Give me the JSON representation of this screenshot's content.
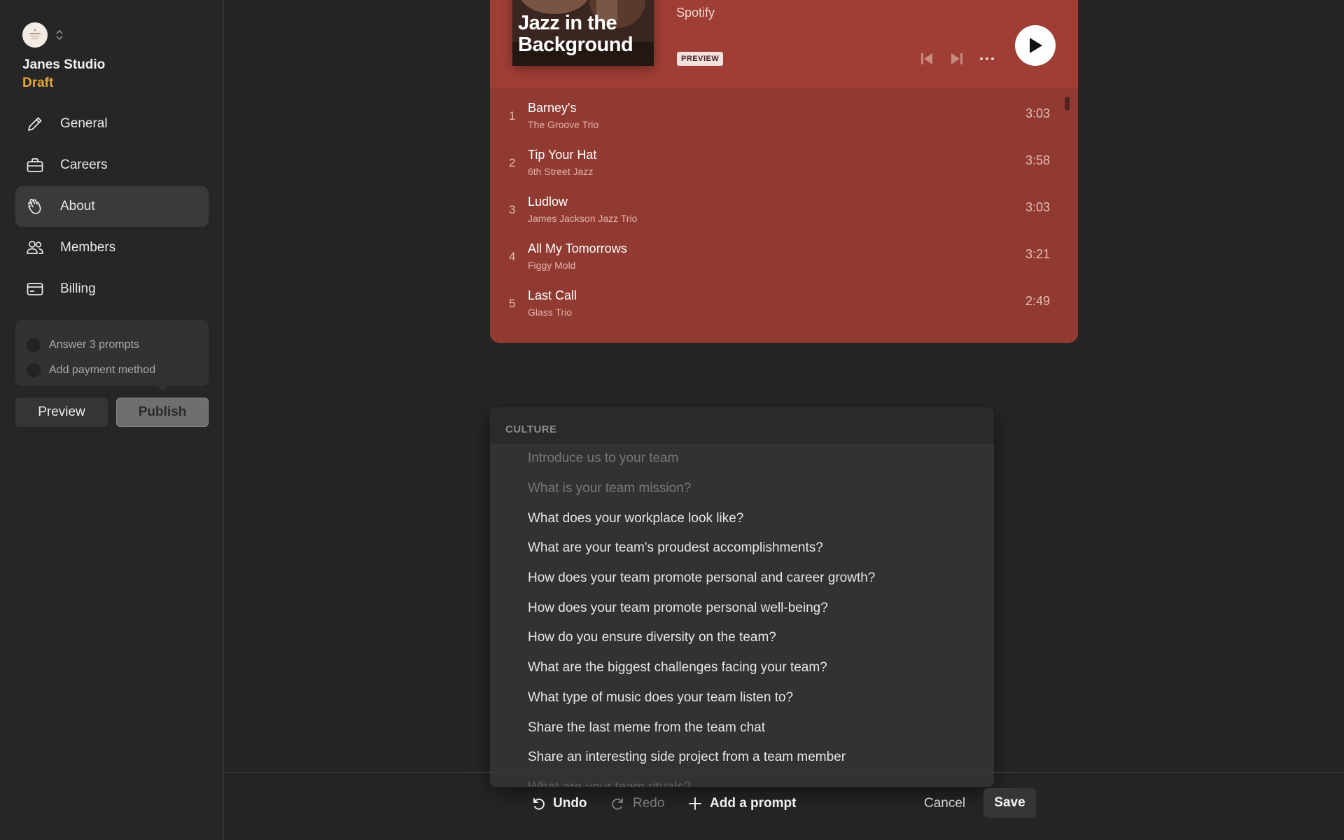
{
  "org": {
    "name": "Janes Studio",
    "status": "Draft"
  },
  "nav": {
    "items": [
      {
        "label": "General",
        "icon": "pencil-icon"
      },
      {
        "label": "Careers",
        "icon": "briefcase-icon"
      },
      {
        "label": "About",
        "icon": "waving-hand-icon",
        "active": true
      },
      {
        "label": "Members",
        "icon": "people-icon"
      },
      {
        "label": "Billing",
        "icon": "credit-card-icon"
      }
    ]
  },
  "checklist": {
    "items": [
      "Answer 3 prompts",
      "Add payment method"
    ]
  },
  "actions": {
    "preview_label": "Preview",
    "publish_label": "Publish"
  },
  "spotify": {
    "cover_title": "Jazz in the Background",
    "artist": "Spotify",
    "badge": "PREVIEW",
    "tracks": [
      {
        "num": "1",
        "title": "Barney's",
        "artist": "The Groove Trio",
        "time": "3:03"
      },
      {
        "num": "2",
        "title": "Tip Your Hat",
        "artist": "6th Street Jazz",
        "time": "3:58"
      },
      {
        "num": "3",
        "title": "Ludlow",
        "artist": "James Jackson Jazz Trio",
        "time": "3:03"
      },
      {
        "num": "4",
        "title": "All My Tomorrows",
        "artist": "Figgy Mold",
        "time": "3:21"
      },
      {
        "num": "5",
        "title": "Last Call",
        "artist": "Glass Trio",
        "time": "2:49"
      }
    ]
  },
  "prompts": {
    "section": "CULTURE",
    "items": [
      {
        "text": "Introduce us to your team",
        "disabled": true
      },
      {
        "text": "What is your team mission?",
        "disabled": true
      },
      {
        "text": "What does your workplace look like?"
      },
      {
        "text": "What are your team's proudest accomplishments?"
      },
      {
        "text": "How does your team promote personal and career growth?"
      },
      {
        "text": "How does your team promote personal well-being?"
      },
      {
        "text": "How do you ensure diversity on the team?"
      },
      {
        "text": "What are the biggest challenges facing your team?"
      },
      {
        "text": "What type of music does your team listen to?"
      },
      {
        "text": "Share the last meme from the team chat"
      },
      {
        "text": "Share an interesting side project from a team member"
      },
      {
        "text": "What are your team rituals?",
        "faded": true
      }
    ]
  },
  "toolbar": {
    "undo": "Undo",
    "redo": "Redo",
    "add_prompt": "Add a prompt",
    "cancel": "Cancel",
    "save": "Save"
  },
  "colors": {
    "accent_draft": "#e9a43a",
    "spotify_bg": "#913a32"
  }
}
